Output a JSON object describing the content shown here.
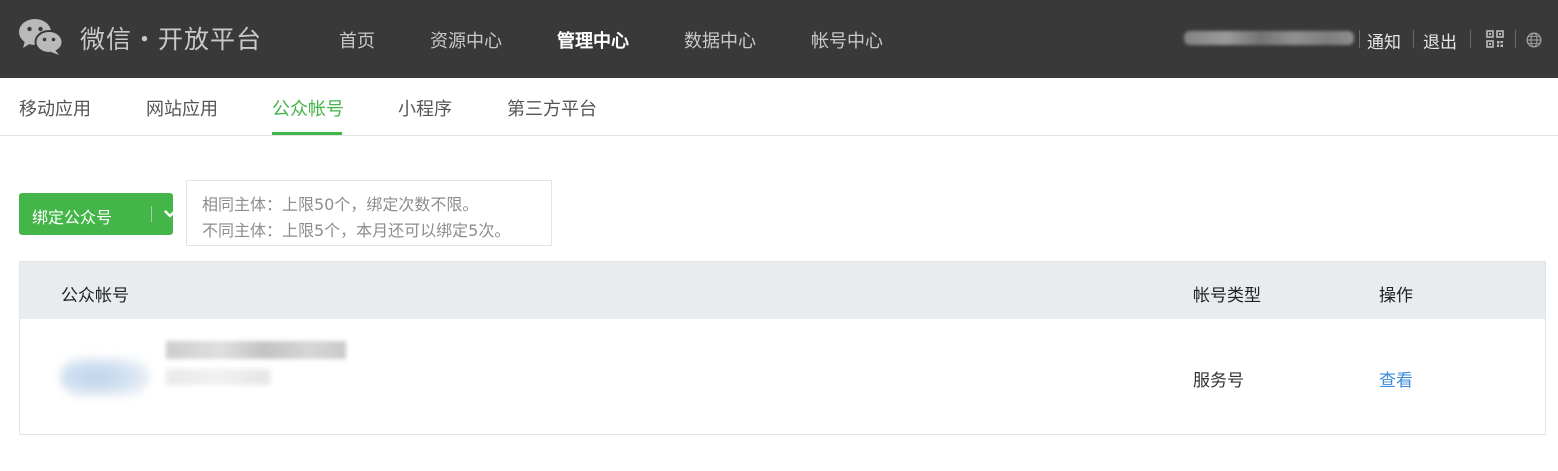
{
  "header": {
    "brand": "微信・开放平台",
    "nav": [
      {
        "label": "首页",
        "active": false
      },
      {
        "label": "资源中心",
        "active": false
      },
      {
        "label": "管理中心",
        "active": true
      },
      {
        "label": "数据中心",
        "active": false
      },
      {
        "label": "帐号中心",
        "active": false
      }
    ],
    "right": {
      "notify": "通知",
      "logout": "退出"
    }
  },
  "subnav": {
    "tabs": [
      {
        "label": "移动应用",
        "active": false
      },
      {
        "label": "网站应用",
        "active": false
      },
      {
        "label": "公众帐号",
        "active": true
      },
      {
        "label": "小程序",
        "active": false
      },
      {
        "label": "第三方平台",
        "active": false
      }
    ]
  },
  "toolbar": {
    "bind_label": "绑定公众号"
  },
  "tip": {
    "line1": "相同主体：上限50个，绑定次数不限。",
    "line2": "不同主体：上限5个，本月还可以绑定5次。"
  },
  "table": {
    "headers": [
      "公众帐号",
      "帐号类型",
      "操作"
    ],
    "rows": [
      {
        "type": "服务号",
        "action": "查看"
      }
    ]
  },
  "colors": {
    "header_bg": "#393939",
    "accent": "#44b549",
    "link": "#3b8cd9",
    "table_head_bg": "#e8ecef"
  },
  "icons": {
    "logo": "wechat-logo-icon",
    "caret": "chevron-down-icon",
    "qr": "qrcode-icon",
    "globe": "globe-icon"
  }
}
